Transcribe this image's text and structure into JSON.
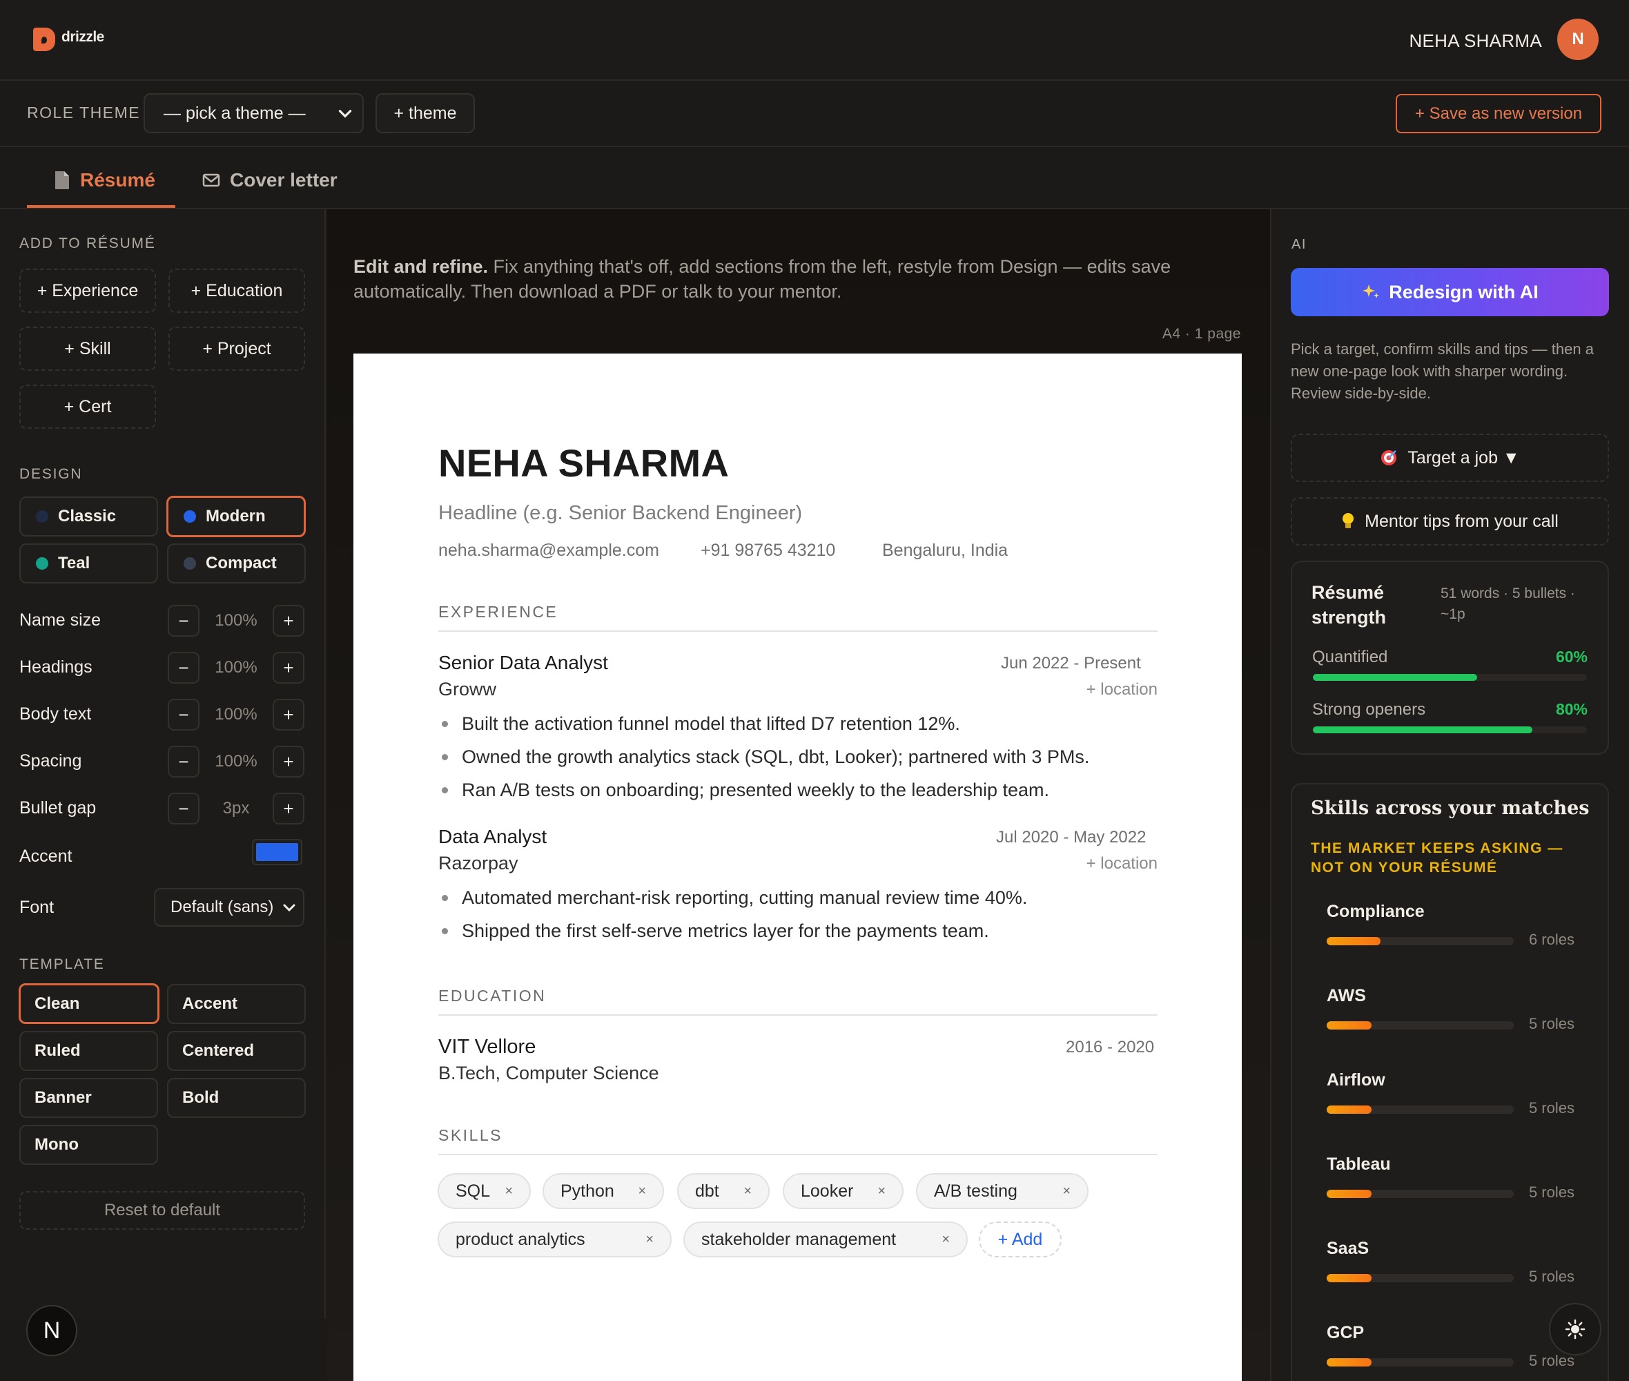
{
  "app": {
    "brand": "drizzle",
    "user_name": "NEHA SHARMA",
    "avatar_initial": "N"
  },
  "theme_bar": {
    "role_theme_label": "ROLE THEME",
    "theme_select_value": "— pick a theme —",
    "add_theme_label": "+ theme",
    "save_version_label": "+ Save as new version"
  },
  "tabs": [
    {
      "label": "Résumé",
      "icon": "document-icon",
      "active": true
    },
    {
      "label": "Cover letter",
      "icon": "mail-icon",
      "active": false
    }
  ],
  "left": {
    "add_label": "ADD TO RÉSUMÉ",
    "add_buttons": [
      "+ Experience",
      "+ Education",
      "+ Skill",
      "+ Project",
      "+ Cert"
    ],
    "design_label": "DESIGN",
    "design_options": [
      {
        "label": "Classic",
        "dot": "#1f2a44",
        "selected": false
      },
      {
        "label": "Modern",
        "dot": "#2563eb",
        "selected": true
      },
      {
        "label": "Teal",
        "dot": "#14a38b",
        "selected": false
      },
      {
        "label": "Compact",
        "dot": "#374151",
        "selected": false
      }
    ],
    "controls": [
      {
        "label": "Name size",
        "value": "100%"
      },
      {
        "label": "Headings",
        "value": "100%"
      },
      {
        "label": "Body text",
        "value": "100%"
      },
      {
        "label": "Spacing",
        "value": "100%"
      },
      {
        "label": "Bullet gap",
        "value": "3px"
      }
    ],
    "accent_label": "Accent",
    "accent_color": "#2563eb",
    "font_label": "Font",
    "font_value": "Default (sans)",
    "template_label": "TEMPLATE",
    "templates": [
      {
        "label": "Clean",
        "selected": true
      },
      {
        "label": "Accent",
        "selected": false
      },
      {
        "label": "Ruled",
        "selected": false
      },
      {
        "label": "Centered",
        "selected": false
      },
      {
        "label": "Banner",
        "selected": false
      },
      {
        "label": "Bold",
        "selected": false
      },
      {
        "label": "Mono",
        "selected": false
      }
    ],
    "reset_label": "Reset to default",
    "n_badge": "N"
  },
  "center": {
    "intro_bold": "Edit and refine.",
    "intro_rest": " Fix anything that's off, add sections from the left, restyle from Design — edits save automatically. Then download a PDF or talk to your mentor.",
    "page_meta": "A4 · 1 page"
  },
  "resume": {
    "name": "NEHA SHARMA",
    "headline_placeholder": "Headline (e.g. Senior Backend Engineer)",
    "email": "neha.sharma@example.com",
    "phone": "+91 98765 43210",
    "location": "Bengaluru, India",
    "experience_label": "EXPERIENCE",
    "jobs": [
      {
        "role": "Senior Data Analyst",
        "company": "Groww",
        "dates": "Jun 2022 -  Present",
        "location": "+ location",
        "bullets": [
          "Built the activation funnel model that lifted D7 retention 12%.",
          "Owned the growth analytics stack (SQL, dbt, Looker); partnered with 3 PMs.",
          "Ran A/B tests on onboarding; presented weekly to the leadership team."
        ]
      },
      {
        "role": "Data Analyst",
        "company": "Razorpay",
        "dates": "Jul 2020 - May 2022",
        "location": "+ location",
        "bullets": [
          "Automated merchant-risk reporting, cutting manual review time 40%.",
          "Shipped the first self-serve metrics layer for the payments team."
        ]
      }
    ],
    "education_label": "EDUCATION",
    "education": {
      "school": "VIT Vellore",
      "degree": "B.Tech, Computer Science",
      "dates": "2016 - 2020"
    },
    "skills_label": "SKILLS",
    "skills": [
      "SQL",
      "Python",
      "dbt",
      "Looker",
      "A/B testing",
      "product analytics",
      "stakeholder management"
    ],
    "add_skill_label": "+ Add",
    "remove_glyph": "×"
  },
  "right": {
    "ai_label": "AI",
    "redesign_label": "Redesign with AI",
    "ai_desc": "Pick a target, confirm skills and tips — then a new one-page look with sharper wording. Review side-by-side.",
    "target_job_label": "Target a job ▼",
    "mentor_tips_label": "Mentor tips from your call",
    "strength": {
      "title": "Résumé strength",
      "meta": "51 words · 5 bullets · ~1p",
      "metrics": [
        {
          "label": "Quantified",
          "value": "60%",
          "fraction": 0.6
        },
        {
          "label": "Strong openers",
          "value": "80%",
          "fraction": 0.8
        }
      ]
    },
    "skills_card": {
      "title": "Skills across your matches",
      "subtitle": "THE MARKET KEEPS ASKING — NOT ON YOUR RÉSUMÉ",
      "items": [
        {
          "name": "Compliance",
          "count": "6 roles",
          "roles": 6
        },
        {
          "name": "AWS",
          "count": "5 roles",
          "roles": 5
        },
        {
          "name": "Airflow",
          "count": "5 roles",
          "roles": 5
        },
        {
          "name": "Tableau",
          "count": "5 roles",
          "roles": 5
        },
        {
          "name": "SaaS",
          "count": "5 roles",
          "roles": 5
        },
        {
          "name": "GCP",
          "count": "5 roles",
          "roles": 5
        }
      ]
    }
  }
}
